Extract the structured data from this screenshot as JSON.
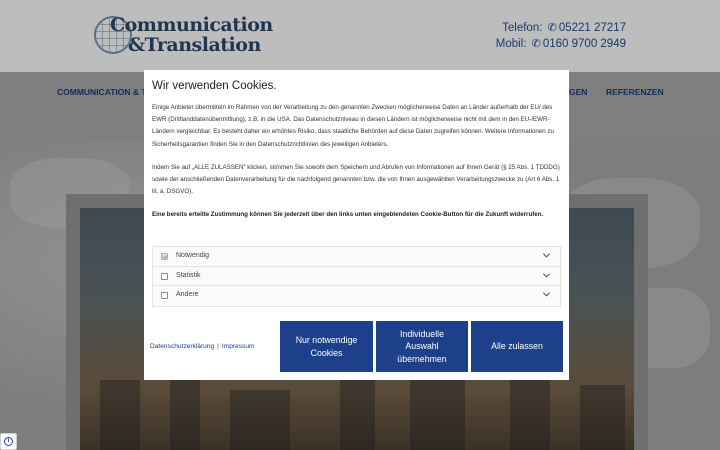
{
  "site": {
    "logo_line1": "Communication",
    "logo_line2": "&Translation",
    "phone_label": "Telefon:",
    "phone_number": "05221 27217",
    "mobile_label": "Mobil:",
    "mobile_number": "0160 9700 2949",
    "nav": [
      {
        "label": "COMMUNICATION & TR"
      },
      {
        "label": "GEN"
      },
      {
        "label": "REFERENZEN"
      }
    ]
  },
  "cookie_dialog": {
    "title": "Wir verwenden Cookies.",
    "paragraph1": "Einige Anbieter übermitteln im Rahmen von der Verarbeitung zu den genannten Zwecken möglicherweise Daten an Länder außerhalb der EU/ des EWR (Drittlanddatenübermittlung), z.B. in die USA. Das Datenschutzniveau in diesen Ländern ist möglicherweise nicht mit dem in den EU-/EWR-Ländern vergleichbar. Es besteht daher ein erhöhtes Risiko, dass staatliche Behörden auf diese Daten zugreifen können. Weitere Informationen zu Sicherheitsgarantien finden Sie in den Datenschutzrichtlinien des jeweiligen Anbieters.",
    "paragraph2": "Indem Sie auf „ALLE ZULASSEN“ klicken, stimmen Sie sowohl dem Speichern und Abrufen von Informationen auf Ihrem Gerät (§ 25 Abs. 1 TDDDG) sowie der anschließenden Datenverarbeitung für die nachfolgend genannten bzw. die von Ihnen ausgewählten Verarbeitungszwecke zu (Art 6 Abs. 1 lit. a. DSGVO).",
    "paragraph3": "Eine bereits erteilte Zustimmung können Sie jederzeit über den links unten eingeblendeten Cookie-Button für die Zukunft widerrufen.",
    "categories": [
      {
        "label": "Notwendig",
        "checked": true
      },
      {
        "label": "Statistik",
        "checked": false
      },
      {
        "label": "Andere",
        "checked": false
      }
    ],
    "link_privacy": "Datenschutzerklärung",
    "link_separator": "|",
    "link_imprint": "Impressum",
    "btn_necessary": "Nur notwendige Cookies",
    "btn_individual": "Individuelle Auswahl übernehmen",
    "btn_accept_all": "Alle zulassen"
  },
  "colors": {
    "primary_button": "#1e3f8a",
    "link": "#1a3c8a",
    "brand_dark": "#1f3550"
  }
}
